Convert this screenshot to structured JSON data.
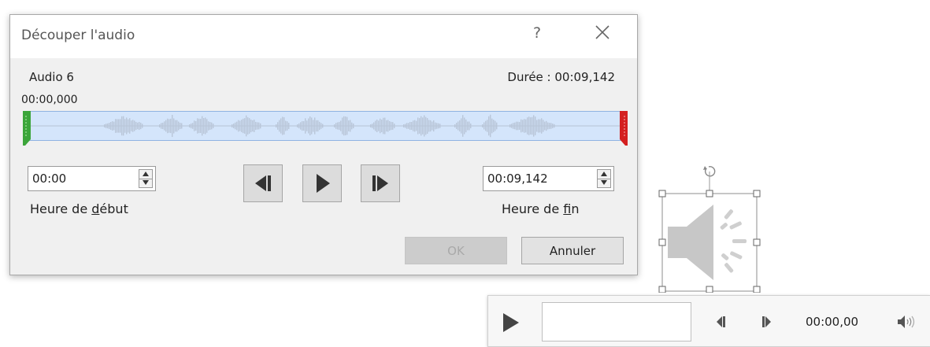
{
  "dialog": {
    "title": "Découper l'audio",
    "help_label": "?",
    "audio_name": "Audio 6",
    "duration_label": "Durée : 00:09,142",
    "current_time": "00:00,000",
    "start": {
      "value": "00:00",
      "caption_pre": "Heure de ",
      "caption_key": "d",
      "caption_post": "ébut"
    },
    "end": {
      "value": "00:09,142",
      "caption_pre": "Heure de ",
      "caption_key": "f",
      "caption_post": "in"
    },
    "ok_label": "OK",
    "cancel_label": "Annuler",
    "colors": {
      "timeline_bg": "#d4e5fb",
      "start_handle": "#3ca53a",
      "end_handle": "#d42020"
    }
  },
  "player": {
    "time": "00:00,00",
    "icons": [
      "play-icon",
      "previous-icon",
      "next-icon",
      "volume-icon"
    ]
  }
}
